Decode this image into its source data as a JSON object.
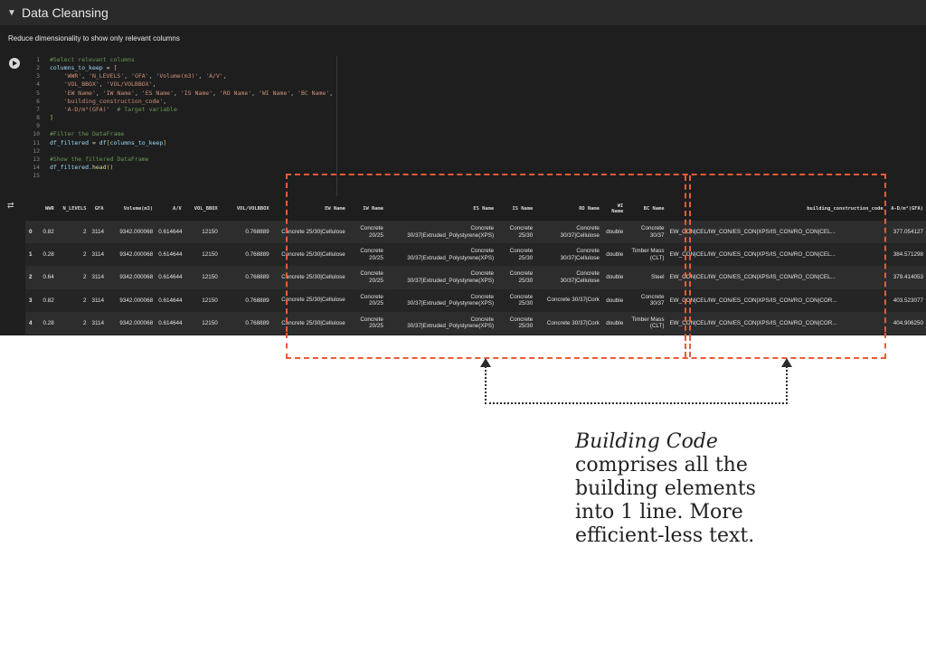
{
  "section": {
    "title": "Data Cleansing",
    "description": "Reduce dimensionality to show only relevant columns"
  },
  "code": [
    {
      "n": "1",
      "tokens": [
        [
          "c",
          "#Select relevant columns"
        ]
      ]
    },
    {
      "n": "2",
      "tokens": [
        [
          "v",
          "columns_to_keep"
        ],
        [
          "d",
          " = "
        ],
        [
          "b",
          "["
        ]
      ]
    },
    {
      "n": "3",
      "tokens": [
        [
          "d",
          "    "
        ],
        [
          "s",
          "'WWR'"
        ],
        [
          "d",
          ", "
        ],
        [
          "s",
          "'N_LEVELS'"
        ],
        [
          "d",
          ", "
        ],
        [
          "s",
          "'GFA'"
        ],
        [
          "d",
          ", "
        ],
        [
          "s",
          "'Volume(m3)'"
        ],
        [
          "d",
          ", "
        ],
        [
          "s",
          "'A/V'"
        ],
        [
          "d",
          ","
        ]
      ]
    },
    {
      "n": "4",
      "tokens": [
        [
          "d",
          "    "
        ],
        [
          "s",
          "'VOL_BBOX'"
        ],
        [
          "d",
          ", "
        ],
        [
          "s",
          "'VOL/VOLBBOX'"
        ],
        [
          "d",
          ","
        ]
      ]
    },
    {
      "n": "5",
      "tokens": [
        [
          "d",
          "    "
        ],
        [
          "s",
          "'EW Name'"
        ],
        [
          "d",
          ", "
        ],
        [
          "s",
          "'IW Name'"
        ],
        [
          "d",
          ", "
        ],
        [
          "s",
          "'ES Name'"
        ],
        [
          "d",
          ", "
        ],
        [
          "s",
          "'IS Name'"
        ],
        [
          "d",
          ", "
        ],
        [
          "s",
          "'RO Name'"
        ],
        [
          "d",
          ", "
        ],
        [
          "s",
          "'WI Name'"
        ],
        [
          "d",
          ", "
        ],
        [
          "s",
          "'BC Name'"
        ],
        [
          "d",
          ","
        ]
      ]
    },
    {
      "n": "6",
      "tokens": [
        [
          "d",
          "    "
        ],
        [
          "s",
          "'building_construction_code'"
        ],
        [
          "d",
          ","
        ]
      ]
    },
    {
      "n": "7",
      "tokens": [
        [
          "d",
          "    "
        ],
        [
          "s",
          "'A-D/m²(GFA)'"
        ],
        [
          "d",
          "  "
        ],
        [
          "c",
          "# Target variable"
        ]
      ]
    },
    {
      "n": "8",
      "tokens": [
        [
          "b",
          "]"
        ]
      ]
    },
    {
      "n": "9",
      "tokens": []
    },
    {
      "n": "10",
      "tokens": [
        [
          "c",
          "#Filter the DataFrame"
        ]
      ]
    },
    {
      "n": "11",
      "tokens": [
        [
          "v",
          "df_filtered"
        ],
        [
          "d",
          " = "
        ],
        [
          "v",
          "df"
        ],
        [
          "b",
          "["
        ],
        [
          "v",
          "columns_to_keep"
        ],
        [
          "b",
          "]"
        ]
      ]
    },
    {
      "n": "12",
      "tokens": []
    },
    {
      "n": "13",
      "tokens": [
        [
          "c",
          "#Show the filtered DataFrame"
        ]
      ]
    },
    {
      "n": "14",
      "tokens": [
        [
          "v",
          "df_filtered"
        ],
        [
          "d",
          "."
        ],
        [
          "f",
          "head"
        ],
        [
          "b",
          "()"
        ]
      ]
    },
    {
      "n": "15",
      "tokens": []
    }
  ],
  "table": {
    "columns": [
      "",
      "WWR",
      "N_LEVELS",
      "GFA",
      "Volume(m3)",
      "A/V",
      "VOL_BBOX",
      "VOL/VOLBBOX",
      "EW Name",
      "IW Name",
      "ES Name",
      "IS Name",
      "RO Name",
      "WI Name",
      "BC Name",
      "building_construction_code",
      "A-D/m²(GFA)"
    ],
    "rows": [
      [
        "0",
        "0.82",
        "2",
        "3114",
        "9342.000068",
        "0.614644",
        "12150",
        "0.768889",
        "Concrete 25/30|Cellulose",
        "Concrete 20/25",
        "Concrete 30/37|Extruded_Polystyrene(XPS)",
        "Concrete 25/30",
        "Concrete 30/37|Cellulose",
        "double",
        "Concrete 30/37",
        "EW_CON|CEL/IW_CON/ES_CON|XPS/IS_CON/RO_CON|CEL...",
        "377.054127"
      ],
      [
        "1",
        "0.28",
        "2",
        "3114",
        "9342.000068",
        "0.614644",
        "12150",
        "0.768889",
        "Concrete 25/30|Cellulose",
        "Concrete 20/25",
        "Concrete 30/37|Extruded_Polystyrene(XPS)",
        "Concrete 25/30",
        "Concrete 30/37|Cellulose",
        "double",
        "Timber Mass (CLT)",
        "EW_CON|CEL/IW_CON/ES_CON|XPS/IS_CON/RO_CON|CEL...",
        "384.571298"
      ],
      [
        "2",
        "0.64",
        "2",
        "3114",
        "9342.000068",
        "0.614644",
        "12150",
        "0.768889",
        "Concrete 25/30|Cellulose",
        "Concrete 20/25",
        "Concrete 30/37|Extruded_Polystyrene(XPS)",
        "Concrete 25/30",
        "Concrete 30/37|Cellulose",
        "double",
        "Steel",
        "EW_CON|CEL/IW_CON/ES_CON|XPS/IS_CON/RO_CON|CEL...",
        "379.414053"
      ],
      [
        "3",
        "0.82",
        "2",
        "3114",
        "9342.000068",
        "0.614644",
        "12150",
        "0.768889",
        "Concrete 25/30|Cellulose",
        "Concrete 20/25",
        "Concrete 30/37|Extruded_Polystyrene(XPS)",
        "Concrete 25/30",
        "Concrete 30/37|Cork",
        "double",
        "Concrete 30/37",
        "EW_CON|CEL/IW_CON/ES_CON|XPS/IS_CON/RO_CON|COR...",
        "403.523077"
      ],
      [
        "4",
        "0.28",
        "2",
        "3114",
        "9342.000068",
        "0.614644",
        "12150",
        "0.768889",
        "Concrete 25/30|Cellulose",
        "Concrete 20/25",
        "Concrete 30/37|Extruded_Polystyrene(XPS)",
        "Concrete 25/30",
        "Concrete 30/37|Cork",
        "double",
        "Timber Mass (CLT)",
        "EW_CON|CEL/IW_CON/ES_CON|XPS/IS_CON/RO_CON|COR...",
        "404.906250"
      ]
    ]
  },
  "annotation": {
    "emphasis": "Building Code",
    "rest": "comprises all the building elements into 1 line. More efficient-less text."
  },
  "icons": {
    "collapse": "chevron-down-icon",
    "run": "play-icon",
    "output": "output-toggle-icon"
  },
  "colors": {
    "highlight": "#ea5b3a",
    "connector": "#2b2b2b",
    "background": "#1e1e1e"
  }
}
